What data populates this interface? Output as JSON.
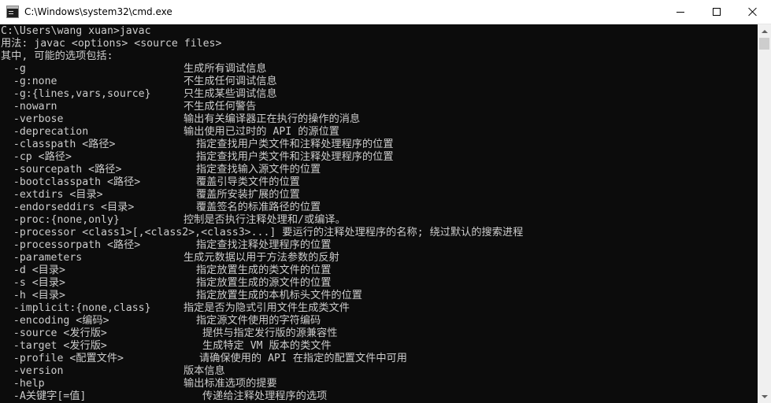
{
  "window": {
    "title": "C:\\Windows\\system32\\cmd.exe",
    "icon": "console-icon"
  },
  "console": {
    "lines": [
      {
        "opt": "C:\\Users\\wang xuan>javac",
        "desc": "",
        "indent": ""
      },
      {
        "opt": "用法: javac <options> <source files>",
        "desc": "",
        "indent": ""
      },
      {
        "opt": "其中, 可能的选项包括:",
        "desc": "",
        "indent": ""
      },
      {
        "opt": "  -g",
        "desc": "生成所有调试信息",
        "indent": ""
      },
      {
        "opt": "  -g:none",
        "desc": "不生成任何调试信息",
        "indent": ""
      },
      {
        "opt": "  -g:{lines,vars,source}",
        "desc": "只生成某些调试信息",
        "indent": ""
      },
      {
        "opt": "  -nowarn",
        "desc": "不生成任何警告",
        "indent": ""
      },
      {
        "opt": "  -verbose",
        "desc": "输出有关编译器正在执行的操作的消息",
        "indent": ""
      },
      {
        "opt": "  -deprecation",
        "desc": "输出使用已过时的 API 的源位置",
        "indent": ""
      },
      {
        "opt": "  -classpath <路径>",
        "desc": "指定查找用户类文件和注释处理程序的位置",
        "indent": "i1"
      },
      {
        "opt": "  -cp <路径>",
        "desc": "指定查找用户类文件和注释处理程序的位置",
        "indent": "i1"
      },
      {
        "opt": "  -sourcepath <路径>",
        "desc": "指定查找输入源文件的位置",
        "indent": "i1"
      },
      {
        "opt": "  -bootclasspath <路径>",
        "desc": "覆盖引导类文件的位置",
        "indent": "i1"
      },
      {
        "opt": "  -extdirs <目录>",
        "desc": "覆盖所安装扩展的位置",
        "indent": "i1"
      },
      {
        "opt": "  -endorseddirs <目录>",
        "desc": "覆盖签名的标准路径的位置",
        "indent": "i1"
      },
      {
        "opt": "  -proc:{none,only}",
        "desc": "控制是否执行注释处理和/或编译。",
        "indent": ""
      },
      {
        "opt": "  -processor <class1>[,<class2>,<class3>...] 要运行的注释处理程序的名称; 绕过默认的搜索进程",
        "desc": "",
        "indent": ""
      },
      {
        "opt": "  -processorpath <路径>",
        "desc": "指定查找注释处理程序的位置",
        "indent": "i1"
      },
      {
        "opt": "  -parameters",
        "desc": "生成元数据以用于方法参数的反射",
        "indent": ""
      },
      {
        "opt": "  -d <目录>",
        "desc": "指定放置生成的类文件的位置",
        "indent": "i1"
      },
      {
        "opt": "  -s <目录>",
        "desc": "指定放置生成的源文件的位置",
        "indent": "i1"
      },
      {
        "opt": "  -h <目录>",
        "desc": "指定放置生成的本机标头文件的位置",
        "indent": "i1"
      },
      {
        "opt": "  -implicit:{none,class}",
        "desc": "指定是否为隐式引用文件生成类文件",
        "indent": ""
      },
      {
        "opt": "  -encoding <编码>",
        "desc": "指定源文件使用的字符编码",
        "indent": "i1"
      },
      {
        "opt": "  -source <发行版>",
        "desc": "提供与指定发行版的源兼容性",
        "indent": "i2"
      },
      {
        "opt": "  -target <发行版>",
        "desc": "生成特定 VM 版本的类文件",
        "indent": "i2"
      },
      {
        "opt": "  -profile <配置文件>",
        "desc": "请确保使用的 API 在指定的配置文件中可用",
        "indent": "i3"
      },
      {
        "opt": "  -version",
        "desc": "版本信息",
        "indent": ""
      },
      {
        "opt": "  -help",
        "desc": "输出标准选项的提要",
        "indent": ""
      },
      {
        "opt": "  -A关键字[=值]",
        "desc": "传递给注释处理程序的选项",
        "indent": "i2"
      }
    ]
  }
}
